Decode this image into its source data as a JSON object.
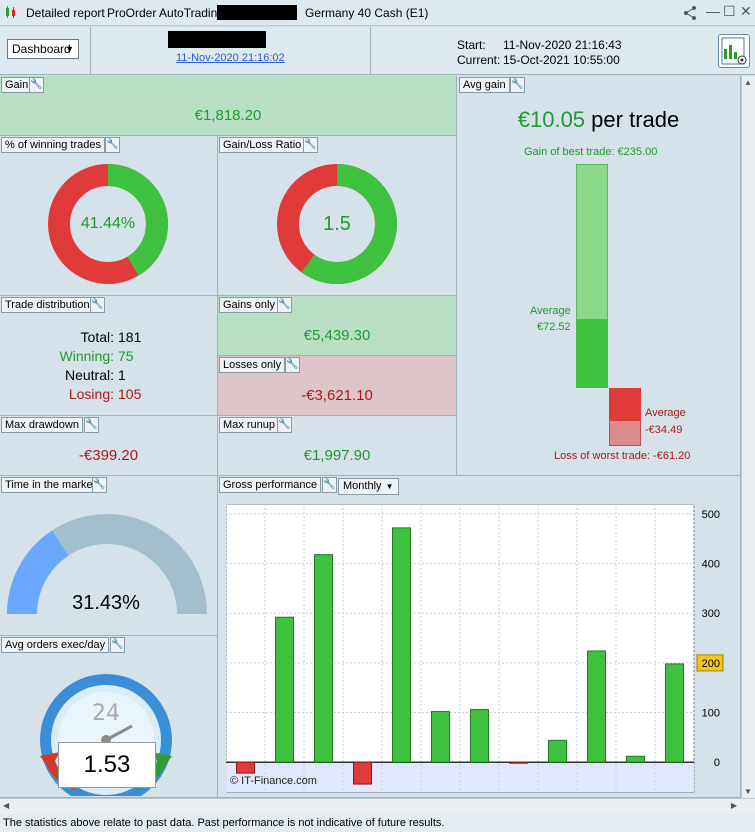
{
  "titlebar": {
    "tab_report": "Detailed report",
    "tab_autotrading": "ProOrder AutoTrading",
    "instrument": "Germany 40 Cash (E1)"
  },
  "header": {
    "dashboard_label": "Dashboard",
    "date_link": "11-Nov-2020 21:16:02",
    "start_label": "Start:",
    "start_value": "11-Nov-2020 21:16:43",
    "current_label": "Current:",
    "current_value": "15-Oct-2021 10:55:00"
  },
  "gain": {
    "title": "Gain",
    "value": "€1,818.20"
  },
  "winning": {
    "title": "% of winning trades",
    "value": "41.44%",
    "fraction": 0.4144
  },
  "ratio": {
    "title": "Gain/Loss Ratio",
    "value": "1.5",
    "fraction": 0.6
  },
  "avg_gain": {
    "title": "Avg gain",
    "value": "€10.05",
    "suffix": "per trade",
    "best_label": "Gain of best trade: €235.00",
    "avg_pos_label": "Average",
    "avg_pos_value": "€72.52",
    "avg_neg_label": "Average",
    "avg_neg_value": "-€34.49",
    "worst_label": "Loss of worst trade: -€61.20",
    "best": 235.0,
    "avg_pos": 72.52,
    "avg_neg": -34.49,
    "worst": -61.2
  },
  "distribution": {
    "title": "Trade distribution",
    "total_label": "Total:",
    "total": "181",
    "winning_label": "Winning:",
    "winning": "75",
    "neutral_label": "Neutral:",
    "neutral": "1",
    "losing_label": "Losing:",
    "losing": "105"
  },
  "gains_only": {
    "title": "Gains only",
    "value": "€5,439.30"
  },
  "losses_only": {
    "title": "Losses only",
    "value": "-€3,621.10"
  },
  "drawdown": {
    "title": "Max drawdown",
    "value": "-€399.20"
  },
  "runup": {
    "title": "Max runup",
    "value": "€1,997.90"
  },
  "market_time": {
    "title": "Time in the market",
    "value": "31.43%",
    "fraction": 0.3143
  },
  "orders": {
    "title": "Avg orders exec/day",
    "value": "1.53",
    "dial": "24"
  },
  "gross": {
    "title": "Gross performance",
    "period": "Monthly",
    "watermark": "© IT-Finance.com",
    "highlight": "200"
  },
  "chart_data": {
    "type": "bar",
    "title": "Gross performance",
    "values": [
      -22,
      292,
      418,
      -44,
      472,
      102,
      106,
      -2,
      44,
      224,
      12,
      198
    ],
    "ylim": [
      -60,
      520
    ],
    "yticks": [
      "500",
      "400",
      "300",
      "200",
      "100",
      "0"
    ],
    "grid": true
  },
  "footer": {
    "text": "The statistics above relate to past data. Past performance is not indicative of future results."
  },
  "colors": {
    "green": "#1c9b2e",
    "red": "#b01818",
    "bar_green": "#3ec13e",
    "bar_red": "#e03a3a"
  }
}
